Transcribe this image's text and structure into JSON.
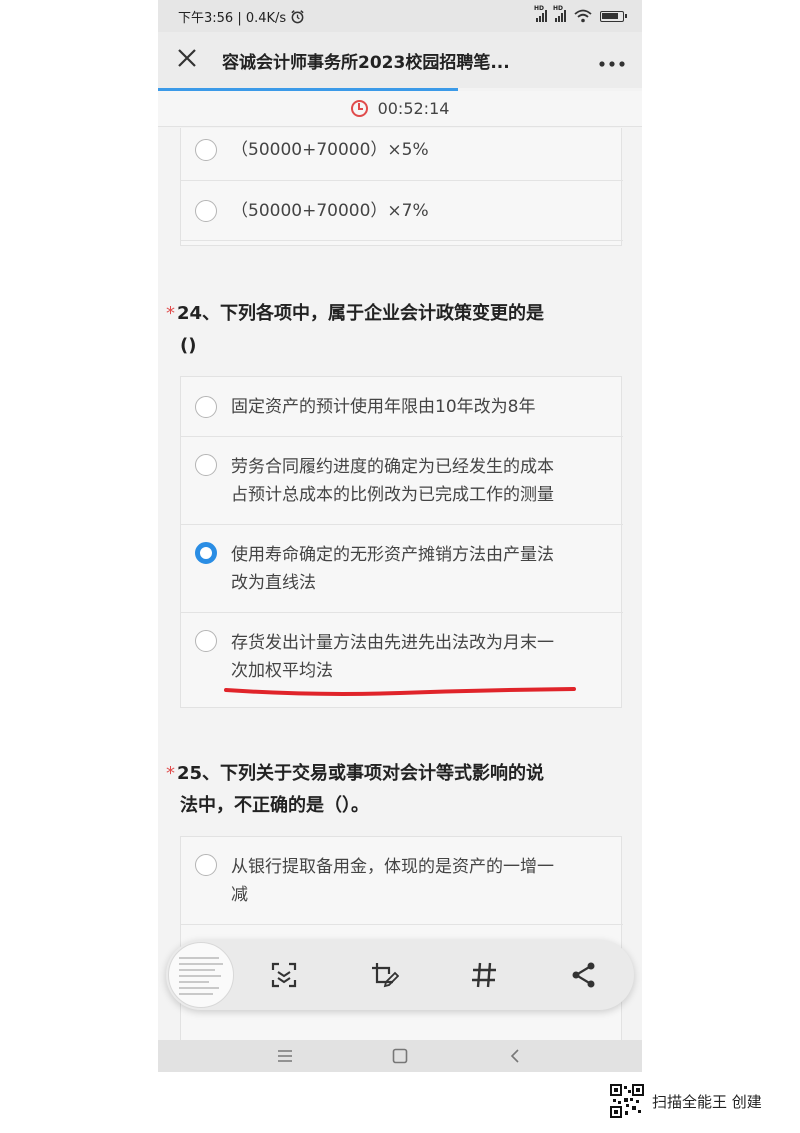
{
  "status_bar": {
    "time_speed": "下午3:56 | 0.4K/s",
    "hd1": "HD",
    "hd2": "HD"
  },
  "header": {
    "title": "容诚会计师事务所2023校园招聘笔...",
    "close_icon": "close-icon",
    "more_icon": "more-icon"
  },
  "progress_fraction": 0.62,
  "timer": {
    "value": "00:52:14",
    "icon": "clock-icon",
    "color": "#e04b4b"
  },
  "q23": {
    "options": [
      {
        "text": "（50000+70000）×5%",
        "checked": false
      },
      {
        "text": "（50000+70000）×7%",
        "checked": false
      }
    ]
  },
  "q24": {
    "star": "*",
    "title_line1": "24、下列各项中，属于企业会计政策变更的是",
    "title_line2": "()",
    "options": [
      {
        "line1": "固定资产的预计使用年限由10年改为8年",
        "line2": "",
        "checked": false
      },
      {
        "line1": "劳务合同履约进度的确定为已经发生的成本",
        "line2": "占预计总成本的比例改为已完成工作的测量",
        "checked": false
      },
      {
        "line1": "使用寿命确定的无形资产摊销方法由产量法",
        "line2": "改为直线法",
        "checked": true
      },
      {
        "line1": "存货发出计量方法由先进先出法改为月末一",
        "line2": "次加权平均法",
        "checked": false
      }
    ]
  },
  "q25": {
    "star": "*",
    "title_line1": "25、下列关于交易或事项对会计等式影响的说",
    "title_line2": "法中，不正确的是（）。",
    "options": [
      {
        "line1": "从银行提取备用金，体现的是资产的一增一",
        "line2": "减",
        "checked": false
      }
    ]
  },
  "toolbar": {
    "buttons": [
      "scan-icon",
      "edit-crop-icon",
      "hashtag-icon",
      "share-icon"
    ]
  },
  "nav": [
    "menu-icon",
    "home-icon",
    "back-icon"
  ],
  "accent_color": "#2a8de4",
  "annotation_color": "#e0242a",
  "watermark": {
    "text": "扫描全能王 创建"
  }
}
